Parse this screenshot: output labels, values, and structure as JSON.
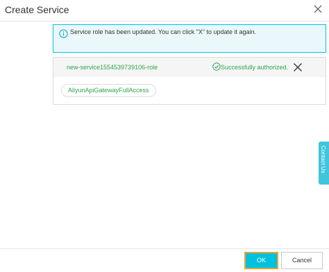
{
  "dialog": {
    "title": "Create Service",
    "close_icon": "close-icon"
  },
  "info_banner": {
    "icon": "info-icon",
    "text": "Service role has been updated. You can click \"X\" to update it again."
  },
  "role_panel": {
    "role_name": "new-service1554539739106-role",
    "status_icon": "check-circle-icon",
    "status_text": "Successfully authorized.",
    "status_color": "#2ea44f",
    "revoke_icon": "close-icon",
    "policies": [
      "AliyunApiGatewayFullAccess"
    ]
  },
  "contact_tab": {
    "label": "Contact Us",
    "color": "#3fc6dc"
  },
  "footer": {
    "ok_label": "OK",
    "cancel_label": "Cancel",
    "accent_color": "#00c1de",
    "focus_color": "#f0a030"
  }
}
